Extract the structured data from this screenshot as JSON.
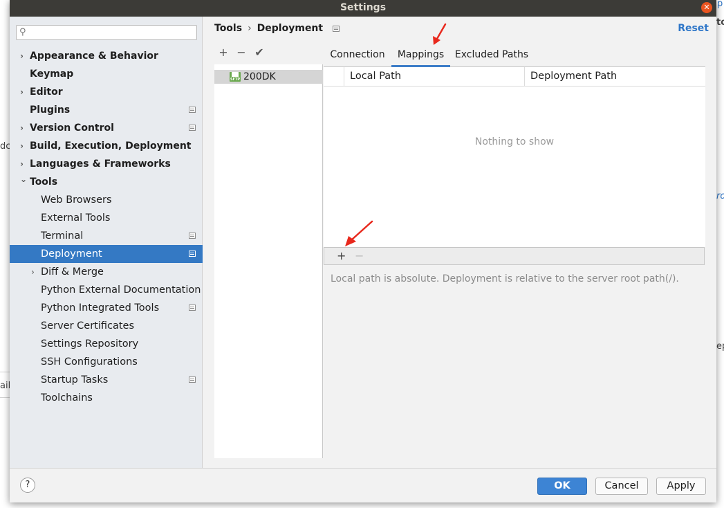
{
  "window": {
    "title": "Settings"
  },
  "background_fragments": [
    "p",
    "to",
    "dc",
    "ro",
    "ep",
    "ail"
  ],
  "search": {
    "placeholder": "",
    "value": ""
  },
  "sidebar": {
    "items": [
      {
        "label": "Appearance & Behavior",
        "level": 0,
        "expandable": true,
        "expanded": false,
        "bold": true,
        "project_icon": false
      },
      {
        "label": "Keymap",
        "level": 0,
        "expandable": false,
        "bold": true,
        "project_icon": false
      },
      {
        "label": "Editor",
        "level": 0,
        "expandable": true,
        "expanded": false,
        "bold": true,
        "project_icon": false
      },
      {
        "label": "Plugins",
        "level": 0,
        "expandable": false,
        "bold": true,
        "project_icon": true
      },
      {
        "label": "Version Control",
        "level": 0,
        "expandable": true,
        "expanded": false,
        "bold": true,
        "project_icon": true
      },
      {
        "label": "Build, Execution, Deployment",
        "level": 0,
        "expandable": true,
        "expanded": false,
        "bold": true,
        "project_icon": false
      },
      {
        "label": "Languages & Frameworks",
        "level": 0,
        "expandable": true,
        "expanded": false,
        "bold": true,
        "project_icon": false
      },
      {
        "label": "Tools",
        "level": 0,
        "expandable": true,
        "expanded": true,
        "bold": true,
        "project_icon": false
      },
      {
        "label": "Web Browsers",
        "level": 1,
        "expandable": false,
        "bold": false,
        "project_icon": false
      },
      {
        "label": "External Tools",
        "level": 1,
        "expandable": false,
        "bold": false,
        "project_icon": false
      },
      {
        "label": "Terminal",
        "level": 1,
        "expandable": false,
        "bold": false,
        "project_icon": true
      },
      {
        "label": "Deployment",
        "level": 1,
        "expandable": false,
        "bold": false,
        "project_icon": true,
        "selected": true
      },
      {
        "label": "Diff & Merge",
        "level": 1,
        "expandable": true,
        "expanded": false,
        "bold": false,
        "project_icon": false
      },
      {
        "label": "Python External Documentation",
        "level": 1,
        "expandable": false,
        "bold": false,
        "project_icon": false
      },
      {
        "label": "Python Integrated Tools",
        "level": 1,
        "expandable": false,
        "bold": false,
        "project_icon": true
      },
      {
        "label": "Server Certificates",
        "level": 1,
        "expandable": false,
        "bold": false,
        "project_icon": false
      },
      {
        "label": "Settings Repository",
        "level": 1,
        "expandable": false,
        "bold": false,
        "project_icon": false
      },
      {
        "label": "SSH Configurations",
        "level": 1,
        "expandable": false,
        "bold": false,
        "project_icon": false
      },
      {
        "label": "Startup Tasks",
        "level": 1,
        "expandable": false,
        "bold": false,
        "project_icon": true
      },
      {
        "label": "Toolchains",
        "level": 1,
        "expandable": false,
        "bold": false,
        "project_icon": false
      }
    ]
  },
  "breadcrumb": {
    "parent": "Tools",
    "separator": "›",
    "current": "Deployment"
  },
  "reset_label": "Reset",
  "server_toolbar": {
    "add": "+",
    "remove": "−",
    "default": "✔"
  },
  "servers": [
    {
      "name": "200DK",
      "type_badge": "SFTP"
    }
  ],
  "tabs": [
    {
      "label": "Connection",
      "active": false
    },
    {
      "label": "Mappings",
      "active": true
    },
    {
      "label": "Excluded Paths",
      "active": false
    }
  ],
  "mappings_table": {
    "columns": [
      "Local Path",
      "Deployment Path"
    ],
    "rows": [],
    "empty_text": "Nothing to show"
  },
  "table_toolbar": {
    "add": "+",
    "remove": "−"
  },
  "hint": "Local path is absolute. Deployment is relative to the server root path(/).",
  "footer": {
    "help": "?",
    "ok": "OK",
    "cancel": "Cancel",
    "apply": "Apply"
  },
  "colors": {
    "selection": "#3479c4",
    "accent": "#3d84d4",
    "link": "#2e76c8",
    "titlebar": "#3c3b37",
    "annotation": "#e8281c"
  }
}
